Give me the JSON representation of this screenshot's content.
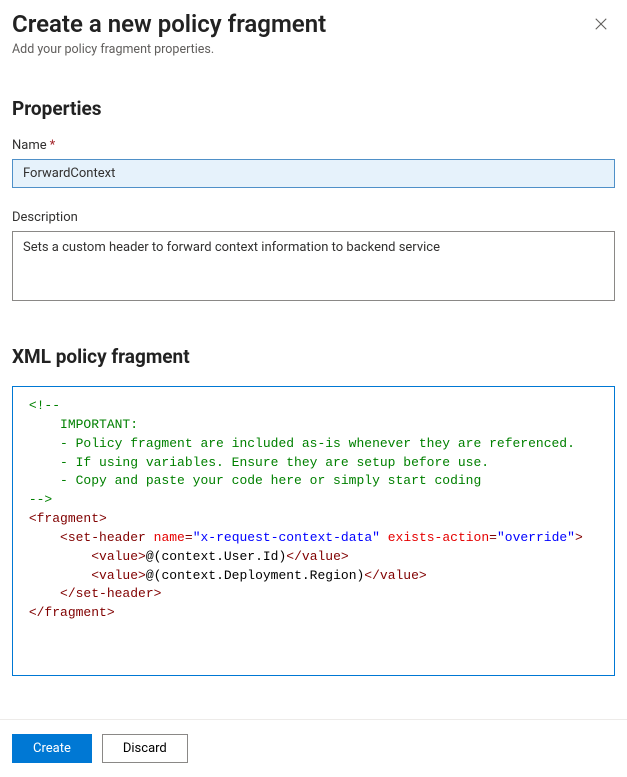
{
  "header": {
    "title": "Create a new policy fragment",
    "subtitle": "Add your policy fragment properties."
  },
  "sections": {
    "properties": "Properties",
    "xml": "XML policy fragment"
  },
  "fields": {
    "name_label": "Name",
    "name_value": "ForwardContext",
    "description_label": "Description",
    "description_value": "Sets a custom header to forward context information to backend service"
  },
  "editor": {
    "lines": {
      "l1a": "<!--",
      "l2": "    IMPORTANT:",
      "l3": "    - Policy fragment are included as-is whenever they are referenced.",
      "l4": "    - If using variables. Ensure they are setup before use.",
      "l5": "    - Copy and paste your code here or simply start coding",
      "l6": "-->",
      "frag_open_name": "fragment",
      "sh_name": "set-header",
      "sh_attr1": "name",
      "sh_attr1v": "\"x-request-context-data\"",
      "sh_attr2": "exists-action",
      "sh_attr2v": "\"override\"",
      "val_tag": "value",
      "val1_text": "@(context.User.Id)",
      "val2_text": "@(context.Deployment.Region)"
    }
  },
  "footer": {
    "create": "Create",
    "discard": "Discard"
  }
}
